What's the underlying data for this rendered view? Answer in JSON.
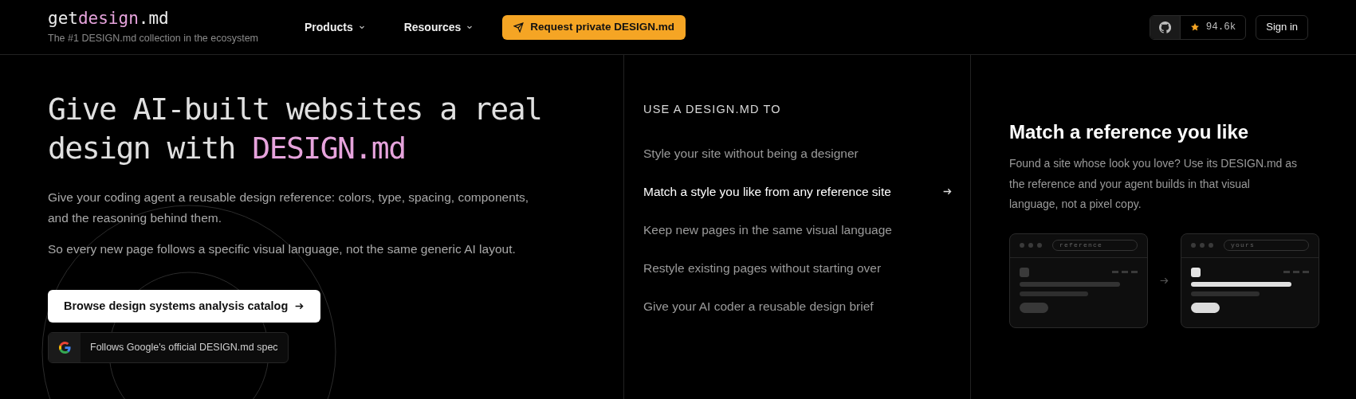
{
  "header": {
    "logo": {
      "prefix": "get",
      "highlight": "design",
      "suffix": ".md"
    },
    "tagline": "The #1 DESIGN.md collection in the ecosystem",
    "nav": [
      {
        "label": "Products"
      },
      {
        "label": "Resources"
      }
    ],
    "cta": "Request private DESIGN.md",
    "stars": "94.6k",
    "sign_in": "Sign in"
  },
  "hero": {
    "title_start": "Give AI-built websites a real design with",
    "title_highlight": "DESIGN.md",
    "paragraphs": [
      "Give your coding agent a reusable design reference: colors, type, spacing, components, and the reasoning behind them.",
      "So every new page follows a specific visual language, not the same generic AI layout."
    ],
    "button": "Browse design systems analysis catalog",
    "badge": "Follows Google's official DESIGN.md spec"
  },
  "uses": {
    "heading": "USE A DESIGN.MD TO",
    "items": [
      {
        "label": "Style your site without being a designer",
        "selected": false
      },
      {
        "label": "Match a style you like from any reference site",
        "selected": true
      },
      {
        "label": "Keep new pages in the same visual language",
        "selected": false
      },
      {
        "label": "Restyle existing pages without starting over",
        "selected": false
      },
      {
        "label": "Give your AI coder a reusable design brief",
        "selected": false
      }
    ]
  },
  "detail": {
    "title": "Match a reference you like",
    "text": "Found a site whose look you love? Use its DESIGN.md as the reference and your agent builds in that visual language, not a pixel copy.",
    "windows": [
      {
        "url": "reference",
        "styled": false
      },
      {
        "url": "yours",
        "styled": true
      }
    ]
  }
}
